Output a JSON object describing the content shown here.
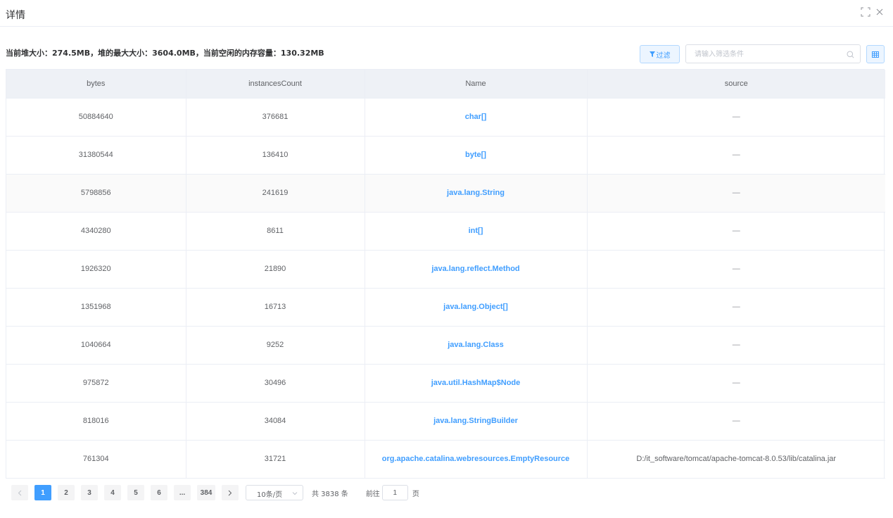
{
  "dialog": {
    "title": "详情"
  },
  "summary": "当前堆大小：274.5MB，堆的最大大小：3604.0MB，当前空闲的内存容量：130.32MB",
  "toolbar": {
    "filter_label": "过滤",
    "search_placeholder": "请输入筛选条件",
    "accent_color": "#409eff"
  },
  "table": {
    "columns": [
      "bytes",
      "instancesCount",
      "Name",
      "source"
    ],
    "rows": [
      {
        "bytes": "50884640",
        "instancesCount": "376681",
        "name": "char[]",
        "source": "—"
      },
      {
        "bytes": "31380544",
        "instancesCount": "136410",
        "name": "byte[]",
        "source": "—"
      },
      {
        "bytes": "5798856",
        "instancesCount": "241619",
        "name": "java.lang.String",
        "source": "—"
      },
      {
        "bytes": "4340280",
        "instancesCount": "8611",
        "name": "int[]",
        "source": "—"
      },
      {
        "bytes": "1926320",
        "instancesCount": "21890",
        "name": "java.lang.reflect.Method",
        "source": "—"
      },
      {
        "bytes": "1351968",
        "instancesCount": "16713",
        "name": "java.lang.Object[]",
        "source": "—"
      },
      {
        "bytes": "1040664",
        "instancesCount": "9252",
        "name": "java.lang.Class",
        "source": "—"
      },
      {
        "bytes": "975872",
        "instancesCount": "30496",
        "name": "java.util.HashMap$Node",
        "source": "—"
      },
      {
        "bytes": "818016",
        "instancesCount": "34084",
        "name": "java.lang.StringBuilder",
        "source": "—"
      },
      {
        "bytes": "761304",
        "instancesCount": "31721",
        "name": "org.apache.catalina.webresources.EmptyResource",
        "source": "D:/it_software/tomcat/apache-tomcat-8.0.53/lib/catalina.jar"
      }
    ]
  },
  "pagination": {
    "pages": [
      "1",
      "2",
      "3",
      "4",
      "5",
      "6",
      "...",
      "384"
    ],
    "current_page": "1",
    "page_size_label": "10条/页",
    "total_label": "共 3838 条",
    "goto_prefix": "前往",
    "goto_value": "1",
    "goto_suffix": "页"
  }
}
